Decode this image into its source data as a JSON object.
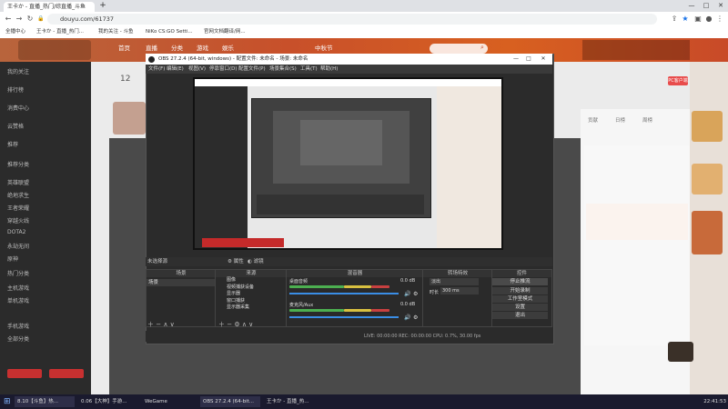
{
  "browser": {
    "tab_title": "王卡か - 直播_热门/综直播_斗鱼",
    "new_tab": "+",
    "url": "douyu.com/61737",
    "bookmarks": [
      "全播中心",
      "王卡か - 直播_热门...",
      "我的关注 - 斗鱼",
      "NiKo CS:GO Setti...",
      "官网文档翻译/网..."
    ]
  },
  "site": {
    "nav": [
      "首页",
      "直播",
      "分类",
      "游戏",
      "娱乐",
      "中秋节"
    ],
    "right_badge": "PC客户端",
    "left_items": [
      "我的关注",
      "排行榜",
      "消费中心",
      "云赞格",
      "推荐",
      "推荐分类",
      "英雄联盟",
      "绝地求生",
      "王者荣耀",
      "穿越火线",
      "DOTA2",
      "永劫无间",
      "原神",
      "热门分类",
      "主机游戏",
      "单机游戏",
      "手机游戏",
      "全部分类"
    ],
    "room_num": "12",
    "tabs": [
      "贡献",
      "日榜",
      "周榜"
    ]
  },
  "obs": {
    "title": "OBS 27.2.4 (64-bit, windows) - 配置文件: 未命名 - 场景: 未命名",
    "menu": [
      "文件(F)",
      "编辑(E)",
      "视图(V)",
      "停靠窗口(D)",
      "配置文件(P)",
      "场景集合(S)",
      "工具(T)",
      "帮助(H)"
    ],
    "no_source": "未选择源",
    "props": "属性",
    "filters": "滤镜",
    "docks": {
      "scenes": "场景",
      "sources": "来源",
      "mixer": "混音器",
      "transitions": "转场特效",
      "controls": "控件"
    },
    "scene_item": "场景",
    "source_items": [
      "图像",
      "视频捕获设备",
      "显示器",
      "窗口捕获",
      "显示器采集"
    ],
    "mixer_items": [
      "桌面音频",
      "麦克风/Aux"
    ],
    "mixer_db": [
      "0.0 dB",
      "0.0 dB"
    ],
    "transition_type": "淡出",
    "duration_label": "时长",
    "duration_value": "300 ms",
    "controls": [
      "停止推流",
      "开始录制",
      "工作室模式",
      "设置",
      "退出"
    ],
    "status": "LIVE: 00:00:00    REC: 00:00:00    CPU: 0.7%, 30.00 fps"
  },
  "taskbar": {
    "items": [
      "8.10【斗鱼】热...",
      "0.06【大神】手游...",
      "WeGame",
      "OBS 27.2.4 (64-bit...",
      "王卡か - 直播_热..."
    ],
    "clock": "22:41:53"
  }
}
